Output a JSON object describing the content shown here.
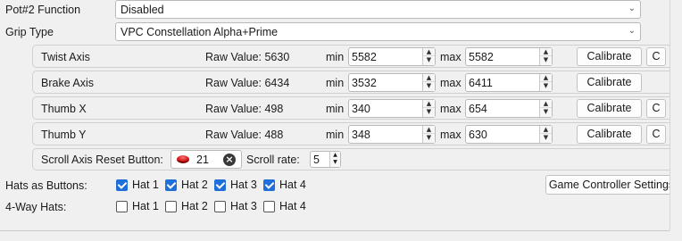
{
  "pot2": {
    "label": "Pot#2 Function",
    "value": "Disabled"
  },
  "grip": {
    "label": "Grip Type",
    "value": "VPC Constellation Alpha+Prime"
  },
  "axes": [
    {
      "name": "Twist Axis",
      "raw_label": "Raw Value: 5630",
      "min_label": "min",
      "min": "5582",
      "max_label": "max",
      "max": "5582",
      "calibrate": "Calibrate",
      "c": "C"
    },
    {
      "name": "Brake Axis",
      "raw_label": "Raw Value: 6434",
      "min_label": "min",
      "min": "3532",
      "max_label": "max",
      "max": "6411",
      "calibrate": "Calibrate"
    },
    {
      "name": "Thumb X",
      "raw_label": "Raw Value: 498",
      "min_label": "min",
      "min": "340",
      "max_label": "max",
      "max": "654",
      "calibrate": "Calibrate",
      "c": "C"
    },
    {
      "name": "Thumb Y",
      "raw_label": "Raw Value: 488",
      "min_label": "min",
      "min": "348",
      "max_label": "max",
      "max": "630",
      "calibrate": "Calibrate",
      "c": "C"
    }
  ],
  "scroll": {
    "reset_label": "Scroll Axis Reset Button:",
    "button_number": "21",
    "rate_label": "Scroll rate:",
    "rate": "5"
  },
  "hats_buttons": {
    "label": "Hats as Buttons:",
    "items": [
      {
        "label": "Hat 1",
        "checked": true
      },
      {
        "label": "Hat 2",
        "checked": true
      },
      {
        "label": "Hat 3",
        "checked": true
      },
      {
        "label": "Hat 4",
        "checked": true
      }
    ]
  },
  "four_way": {
    "label": "4-Way Hats:",
    "items": [
      {
        "label": "Hat 1",
        "checked": false
      },
      {
        "label": "Hat 2",
        "checked": false
      },
      {
        "label": "Hat 3",
        "checked": false
      },
      {
        "label": "Hat 4",
        "checked": false
      }
    ]
  },
  "game_controller_settings": "Game Controller Settings"
}
